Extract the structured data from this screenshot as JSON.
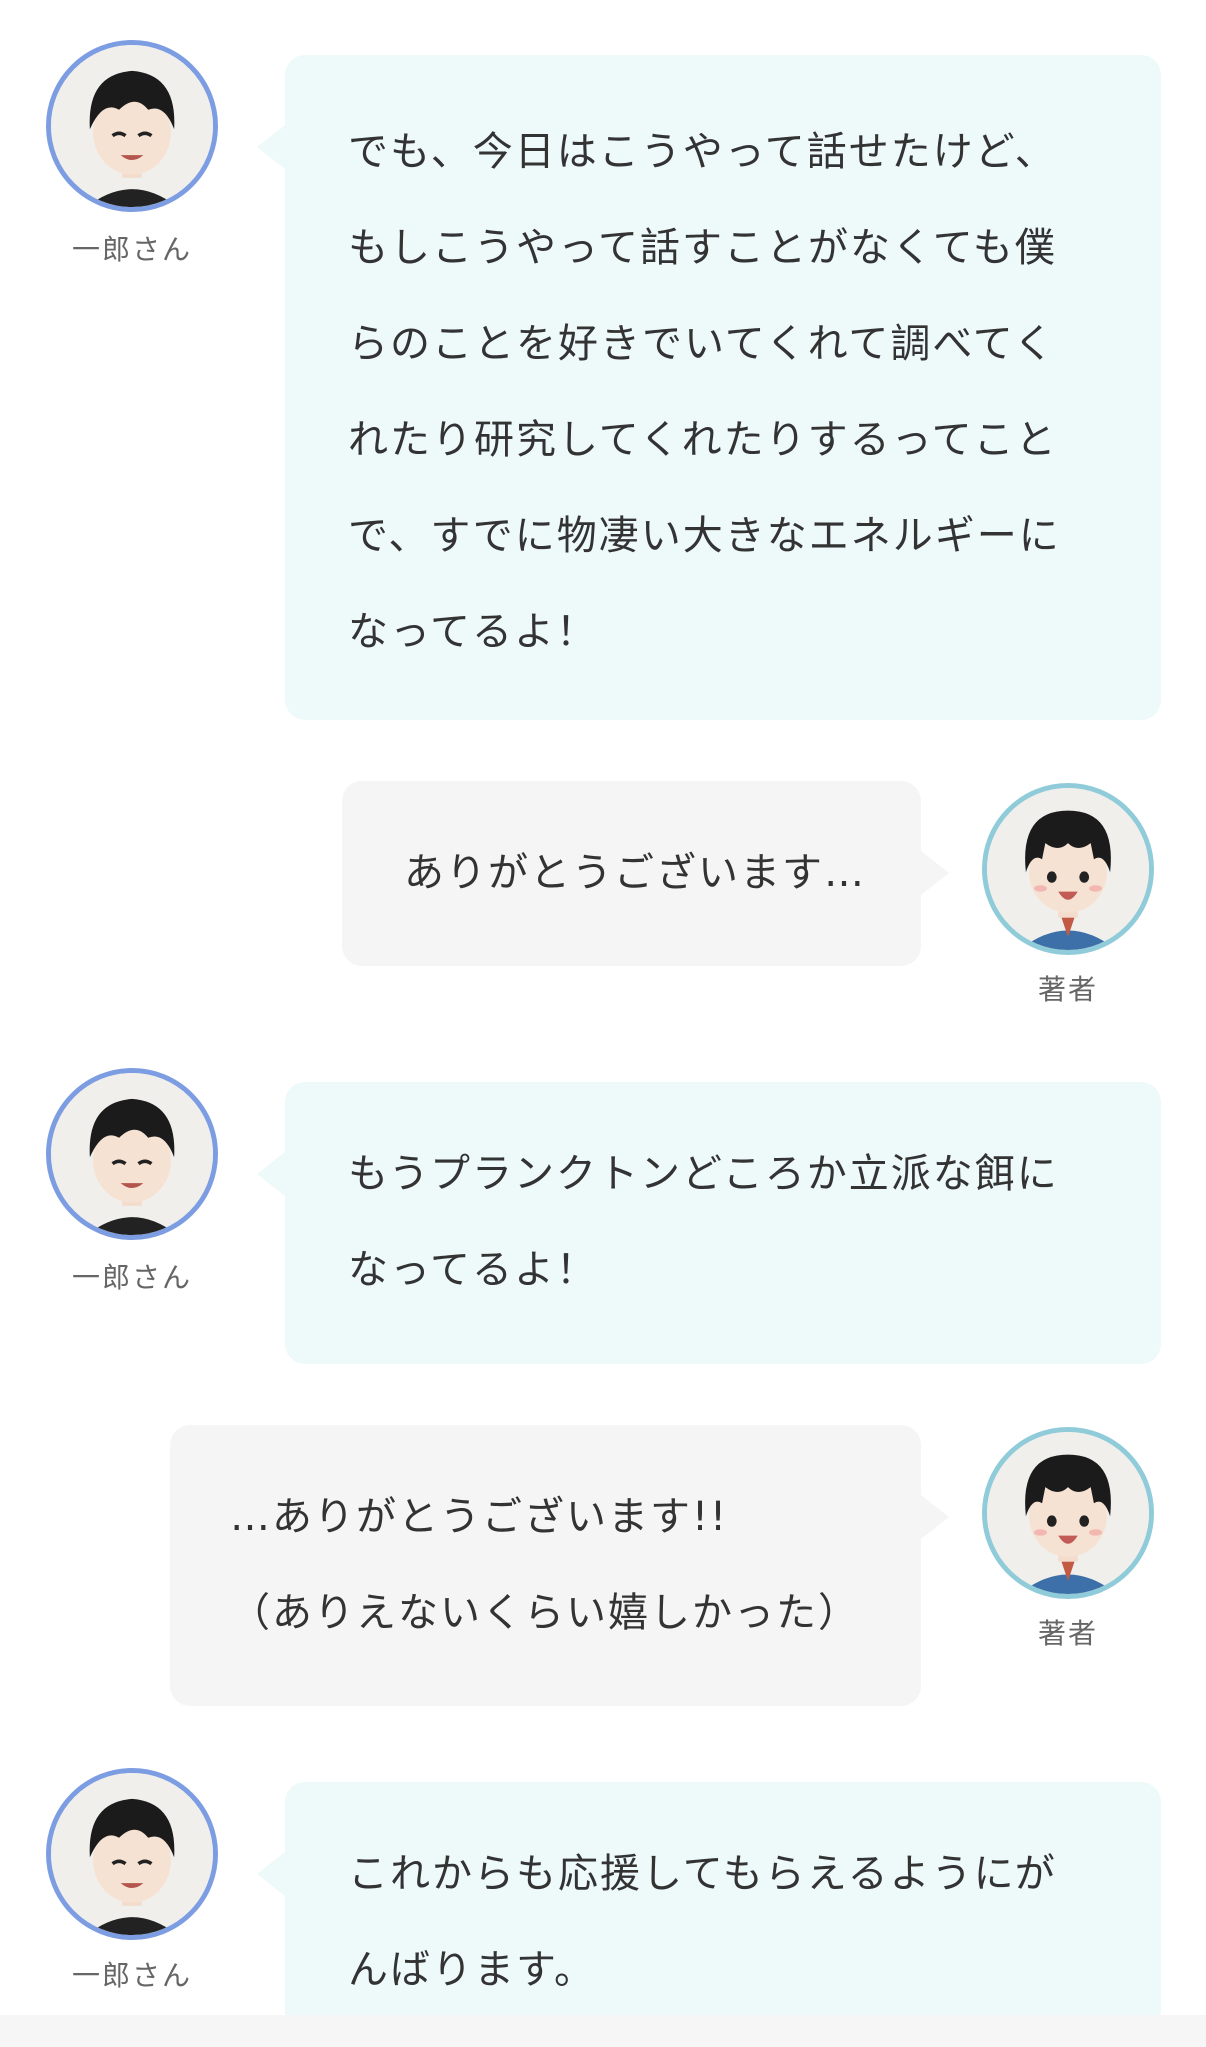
{
  "messages": [
    {
      "speaker": "一郎さん",
      "lines": [
        "でも、今日はこうやって話せたけど、",
        "もしこうやって話すことがなくても僕",
        "らのことを好きでいてくれて調べてく",
        "れたり研究してくれたりするってこと",
        "で、すでに物凄い大きなエネルギーに",
        "なってるよ！"
      ]
    },
    {
      "speaker": "著者",
      "lines": [
        "ありがとうございます…"
      ]
    },
    {
      "speaker": "一郎さん",
      "lines": [
        "もうプランクトンどころか立派な餌に",
        "なってるよ！"
      ]
    },
    {
      "speaker": "著者",
      "lines": [
        "…ありがとうございます!!",
        "（ありえないくらい嬉しかった）"
      ]
    },
    {
      "speaker": "一郎さん",
      "lines": [
        "これからも応援してもらえるようにが",
        "んばります。"
      ]
    }
  ],
  "colors": {
    "ichiro_bubble": "#eef9fa",
    "author_bubble": "#f5f5f5",
    "ichiro_ring": "#7d9de2",
    "author_ring": "#8fcbd9"
  },
  "icons": {
    "ichiro_avatar": "ichiro-avatar-icon",
    "author_avatar": "author-avatar-icon"
  }
}
